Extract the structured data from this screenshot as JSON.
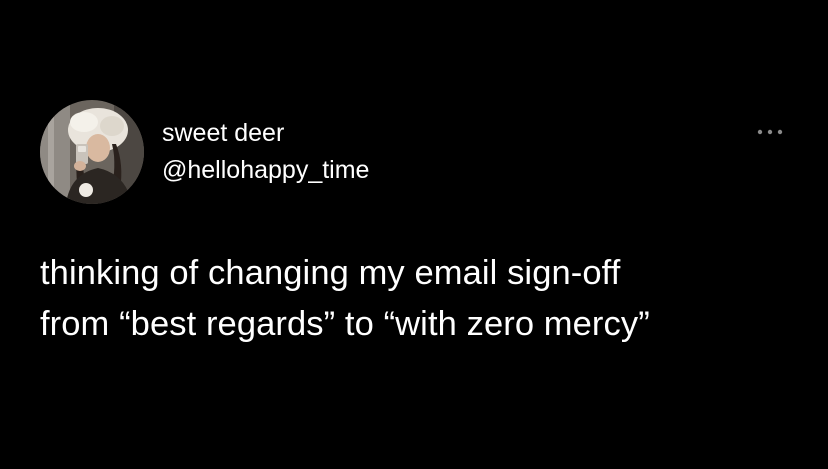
{
  "tweet": {
    "author": {
      "display_name": "sweet deer",
      "handle": "@hellohappy_time",
      "avatar_icon": "profile-photo"
    },
    "more_icon": "more-horizontal-icon",
    "text_lines": [
      "thinking of changing my email sign-off",
      "from “best regards” to “with zero mercy”"
    ]
  },
  "colors": {
    "background": "#000000",
    "text": "#ffffff",
    "more_icon": "#8a8a8a"
  }
}
